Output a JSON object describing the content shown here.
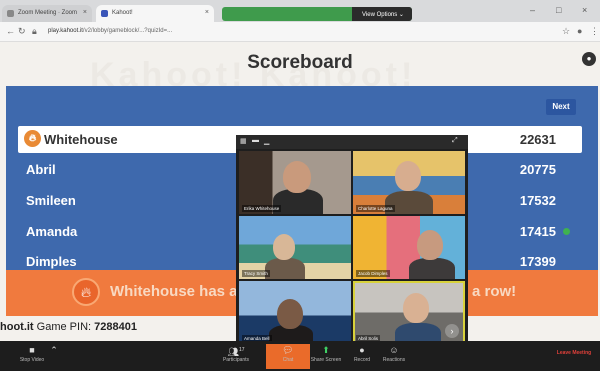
{
  "browser": {
    "tabs": [
      {
        "label": "Zoom Meeting · Zoom"
      },
      {
        "label": "Kahoot!"
      }
    ],
    "zoom_bar": {
      "label": "",
      "view_options": "View Options ⌄"
    },
    "url_host": "play.kahoot.it",
    "url_path": "/v2/lobby/gameblock/...?quizId=...",
    "window_controls": [
      "–",
      "□",
      "×"
    ]
  },
  "page": {
    "watermark": "Kahoot! Kahoot!",
    "title": "Scoreboard",
    "next_label": "Next",
    "players": [
      {
        "name": "Whitehouse",
        "score": "22631"
      },
      {
        "name": "Abril",
        "score": "20775"
      },
      {
        "name": "Smileen",
        "score": "17532"
      },
      {
        "name": "Amanda",
        "score": "17415"
      },
      {
        "name": "Dimples",
        "score": "17399"
      }
    ],
    "banner_left": "Whitehouse has a",
    "banner_right": "a row!",
    "pin_prefix": "hoot.it",
    "pin_label": "Game PIN:",
    "pin_value": "7288401"
  },
  "video": {
    "tiles": [
      {
        "name": "Erika Whitehouse"
      },
      {
        "name": "Charlotte Laguna"
      },
      {
        "name": "Tracy Smith"
      },
      {
        "name": "Jacob Dimples"
      },
      {
        "name": "Amanda Bell"
      },
      {
        "name": "Abril Solis"
      }
    ]
  },
  "zoom_toolbar": {
    "stop_video": "Stop Video",
    "participants": "Participants",
    "participants_count": "17",
    "chat": "Chat",
    "share": "Share Screen",
    "record": "Record",
    "reactions": "Reactions",
    "leave": "Leave Meeting"
  },
  "colors": {
    "board_blue": "#3e69ad",
    "banner_orange": "#f07a3e",
    "leader_avatar": "#e98a35",
    "zoom_green": "#3f9b4c"
  }
}
